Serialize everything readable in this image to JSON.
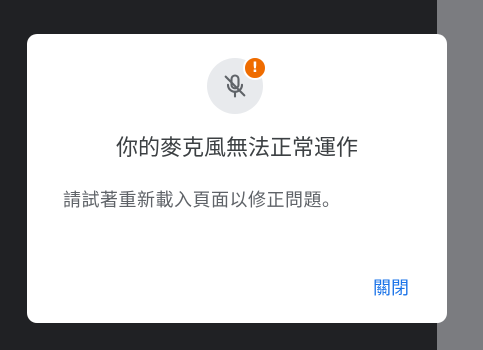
{
  "dialog": {
    "title": "你的麥克風無法正常運作",
    "message": "請試著重新載入頁面以修正問題。",
    "close_label": "關閉",
    "icon": "microphone-off-icon",
    "badge_icon": "alert-icon",
    "badge_symbol": "!"
  },
  "colors": {
    "backdrop": "#202124",
    "side_panel": "#7b7c80",
    "accent": "#1a73e8",
    "badge": "#ef6c00"
  }
}
